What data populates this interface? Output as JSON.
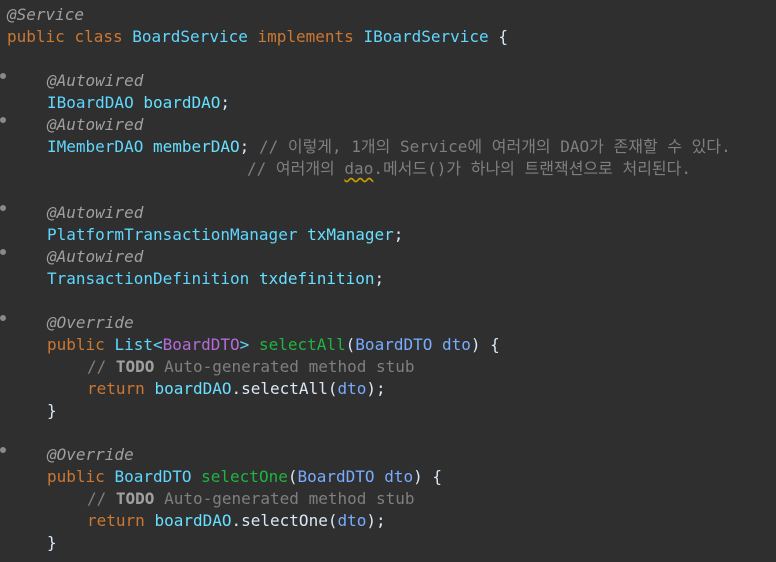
{
  "code": {
    "l1_ann": "@Service",
    "l2_public": "public",
    "l2_class": "class",
    "l2_name": "BoardService",
    "l2_implements": "implements",
    "l2_iface": "IBoardService",
    "l2_brace": "{",
    "l4_ann": "@Autowired",
    "l5_type": "IBoardDAO",
    "l5_var": "boardDAO",
    "l5_semi": ";",
    "l6_ann": "@Autowired",
    "l7_type": "IMemberDAO",
    "l7_var": "memberDAO",
    "l7_semi": ";",
    "l7_comment": "// 이렇게, 1개의 Service에 여러개의 DAO가 존재할 수 있다.",
    "l8_comment_pre": "// 여러개의 ",
    "l8_comment_dao": "dao",
    "l8_comment_post": ".메서드()가 하나의 트랜잭션으로 처리된다.",
    "l10_ann": "@Autowired",
    "l11_type": "PlatformTransactionManager",
    "l11_var": "txManager",
    "l11_semi": ";",
    "l12_ann": "@Autowired",
    "l13_type": "TransactionDefinition",
    "l13_var": "txdefinition",
    "l13_semi": ";",
    "l15_ann": "@Override",
    "l16_public": "public",
    "l16_list": "List<",
    "l16_gen": "BoardDTO",
    "l16_close": ">",
    "l16_method": "selectAll",
    "l16_open": "(",
    "l16_ptype": "BoardDTO",
    "l16_pname": "dto",
    "l16_end": ") {",
    "l17_slashes": "// ",
    "l17_todo": "TODO",
    "l17_rest": " Auto-generated method stub",
    "l18_return": "return",
    "l18_obj": "boardDAO",
    "l18_call": ".selectAll(",
    "l18_arg": "dto",
    "l18_end": ");",
    "l19_brace": "}",
    "l21_ann": "@Override",
    "l22_public": "public",
    "l22_rtype": "BoardDTO",
    "l22_method": "selectOne",
    "l22_open": "(",
    "l22_ptype": "BoardDTO",
    "l22_pname": "dto",
    "l22_end": ") {",
    "l23_slashes": "// ",
    "l23_todo": "TODO",
    "l23_rest": " Auto-generated method stub",
    "l24_return": "return",
    "l24_obj": "boardDAO",
    "l24_call": ".selectOne(",
    "l24_arg": "dto",
    "l24_end": ");",
    "l25_brace": "}"
  },
  "colors": {
    "background": "#2f2f2f",
    "keyword": "#cc7832",
    "type": "#5fd7ff",
    "method": "#1eb540",
    "generic": "#b46bd8",
    "comment": "#7f7f7f",
    "annotation": "#a0a0a0"
  }
}
